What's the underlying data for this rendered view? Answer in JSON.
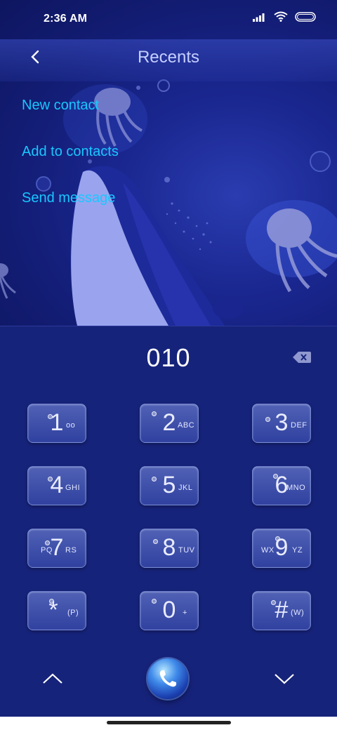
{
  "status_bar": {
    "time": "2:36 AM",
    "icons": [
      "signal-icon",
      "wifi-icon",
      "battery-icon"
    ]
  },
  "header": {
    "title": "Recents",
    "back_icon": "chevron-left-icon"
  },
  "menu": {
    "items": [
      {
        "label": "New contact"
      },
      {
        "label": "Add to contacts"
      },
      {
        "label": "Send message"
      }
    ]
  },
  "display": {
    "number": "010",
    "backspace_icon": "backspace-icon"
  },
  "keypad": {
    "keys": [
      {
        "digit": "1",
        "letters": "oo",
        "pre": ""
      },
      {
        "digit": "2",
        "letters": "ABC",
        "pre": ""
      },
      {
        "digit": "3",
        "letters": "DEF",
        "pre": ""
      },
      {
        "digit": "4",
        "letters": "GHI",
        "pre": ""
      },
      {
        "digit": "5",
        "letters": "JKL",
        "pre": ""
      },
      {
        "digit": "6",
        "letters": "MNO",
        "pre": ""
      },
      {
        "digit": "7",
        "letters": "RS",
        "pre": "PQ"
      },
      {
        "digit": "8",
        "letters": "TUV",
        "pre": ""
      },
      {
        "digit": "9",
        "letters": "YZ",
        "pre": "WX"
      },
      {
        "digit": "*",
        "letters": "(P)",
        "pre": ""
      },
      {
        "digit": "0",
        "letters": "+",
        "pre": ""
      },
      {
        "digit": "#",
        "letters": "(W)",
        "pre": ""
      }
    ]
  },
  "bottom": {
    "up_icon": "chevron-up-icon",
    "call_icon": "phone-icon",
    "down_icon": "chevron-down-icon"
  },
  "colors": {
    "accent": "#19c7ff",
    "background": "#16237a",
    "title": "#c6cfff"
  }
}
